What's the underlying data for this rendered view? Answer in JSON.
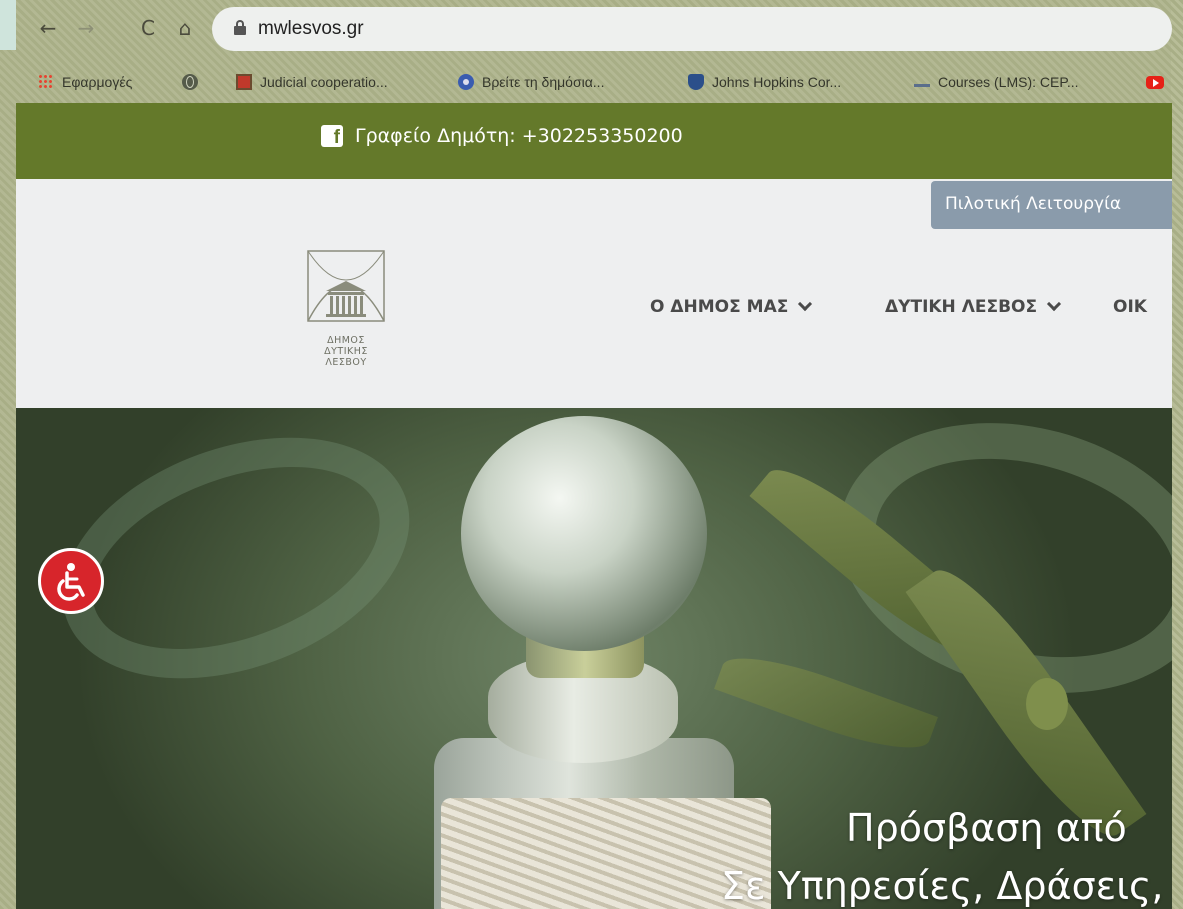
{
  "browser": {
    "url": "mwlesvos.gr",
    "nav": {
      "back_icon": "←",
      "forward_icon": "→",
      "reload_icon": "C",
      "home_icon": "⌂"
    },
    "bookmarks": [
      {
        "label": "Εφαρμογές",
        "icon": "apps-icon"
      },
      {
        "label": "",
        "icon": "globe-icon"
      },
      {
        "label": "Judicial cooperatio...",
        "icon": "eu-icon"
      },
      {
        "label": "Βρείτε τη δημόσια...",
        "icon": "gov-icon"
      },
      {
        "label": "Johns Hopkins Cor...",
        "icon": "jhu-icon"
      },
      {
        "label": "Courses (LMS): CEP...",
        "icon": "cep-icon"
      },
      {
        "label": "",
        "icon": "youtube-icon"
      }
    ]
  },
  "site": {
    "topbar": {
      "office_text": "Γραφείο Δημότη: +302253350200",
      "color": "#64792a"
    },
    "pilot_badge": "Πιλοτική Λειτουργία",
    "logo_lines": [
      "ΔΗΜΟΣ",
      "ΔΥΤΙΚΗΣ",
      "ΛΕΣΒΟΥ"
    ],
    "menu": [
      {
        "label": "Ο ΔΗΜΟΣ ΜΑΣ"
      },
      {
        "label": "ΔΥΤΙΚΗ ΛΕΣΒΟΣ"
      },
      {
        "label": "ΟΙΚ"
      }
    ],
    "hero": {
      "line1": "Πρόσβαση από",
      "line2": "Σε Υπηρεσίες, Δράσεις,"
    },
    "accessibility_color": "#d7252b"
  }
}
